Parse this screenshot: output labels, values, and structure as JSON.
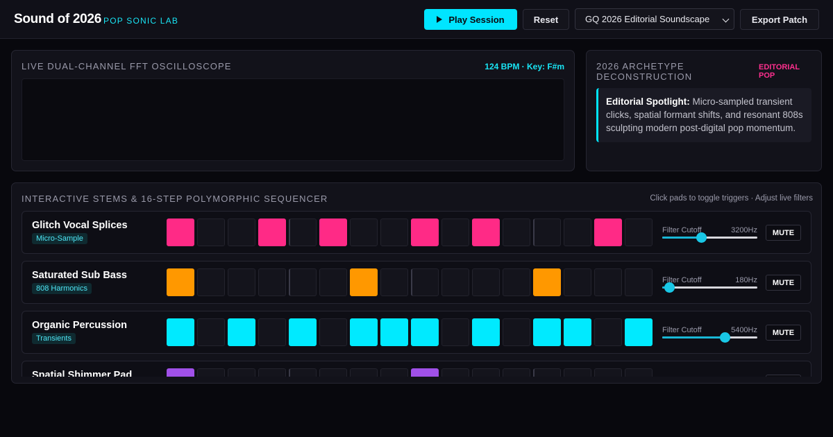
{
  "header": {
    "title": "Sound of 2026",
    "subtitle": "POP SONIC LAB",
    "play_label": "Play Session",
    "reset_label": "Reset",
    "preset_selected": "GQ 2026 Editorial Soundscape",
    "export_label": "Export Patch"
  },
  "oscilloscope": {
    "title": "LIVE DUAL-CHANNEL FFT OSCILLOSCOPE",
    "meta": "124 BPM · Key: F#m"
  },
  "archetype": {
    "title": "2026 ARCHETYPE DECONSTRUCTION",
    "tag": "EDITORIAL POP",
    "spotlight_label": "Editorial Spotlight:",
    "spotlight_text": " Micro-sampled transient clicks, spatial formant shifts, and resonant 808s sculpting modern post-digital pop momentum."
  },
  "sequencer": {
    "title": "INTERACTIVE STEMS & 16-STEP POLYMORPHIC SEQUENCER",
    "hint": "Click pads to toggle triggers · Adjust live filters",
    "filter_label": "Filter Cutoff",
    "mute_label": "MUTE",
    "tracks": [
      {
        "name": "Glitch Vocal Splices",
        "badge": "Micro-Sample",
        "color": "#ff2a86",
        "steps": [
          1,
          0,
          0,
          1,
          0,
          1,
          0,
          0,
          1,
          0,
          1,
          0,
          0,
          0,
          1,
          0
        ],
        "cutoff": "3200Hz",
        "cutoff_level": 0.41
      },
      {
        "name": "Saturated Sub Bass",
        "badge": "808 Harmonics",
        "color": "#ff9800",
        "steps": [
          1,
          0,
          0,
          0,
          0,
          0,
          1,
          0,
          0,
          0,
          0,
          0,
          1,
          0,
          0,
          0
        ],
        "cutoff": "180Hz",
        "cutoff_level": 0.07
      },
      {
        "name": "Organic Percussion",
        "badge": "Transients",
        "color": "#00eaff",
        "steps": [
          1,
          0,
          1,
          0,
          1,
          0,
          1,
          1,
          1,
          0,
          1,
          0,
          1,
          1,
          0,
          1
        ],
        "cutoff": "5400Hz",
        "cutoff_level": 0.66
      },
      {
        "name": "Spatial Shimmer Pad",
        "badge": "",
        "color": "#a050e8",
        "steps": [
          1,
          0,
          0,
          0,
          0,
          0,
          0,
          0,
          1,
          0,
          0,
          0,
          0,
          0,
          0,
          0
        ],
        "cutoff": "",
        "cutoff_level": 0
      }
    ]
  }
}
